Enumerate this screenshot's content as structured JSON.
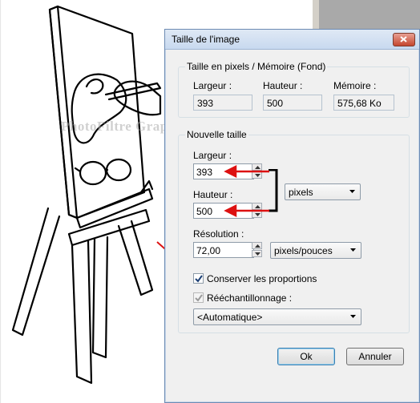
{
  "watermark": "PhotoFiltre Graphic",
  "dialog": {
    "title": "Taille de l'image",
    "current_group": {
      "label": "Taille en pixels / Mémoire (Fond)",
      "width_label": "Largeur :",
      "width_value": "393",
      "height_label": "Hauteur :",
      "height_value": "500",
      "memory_label": "Mémoire :",
      "memory_value": "575,68 Ko"
    },
    "new_group": {
      "label": "Nouvelle taille",
      "width_label": "Largeur :",
      "width_value": "393",
      "height_label": "Hauteur :",
      "height_value": "500",
      "unit_select": "pixels",
      "resolution_label": "Résolution :",
      "resolution_value": "72,00",
      "resolution_unit_select": "pixels/pouces",
      "keep_proportions_label": "Conserver les proportions",
      "keep_proportions_checked": true,
      "resample_label": "Rééchantillonnage :",
      "resample_checked": true,
      "resample_select": "<Automatique>"
    },
    "ok_label": "Ok",
    "cancel_label": "Annuler"
  },
  "colors": {
    "annotation_arrow": "#dd1111",
    "titlebar": "#c8d9ef"
  }
}
